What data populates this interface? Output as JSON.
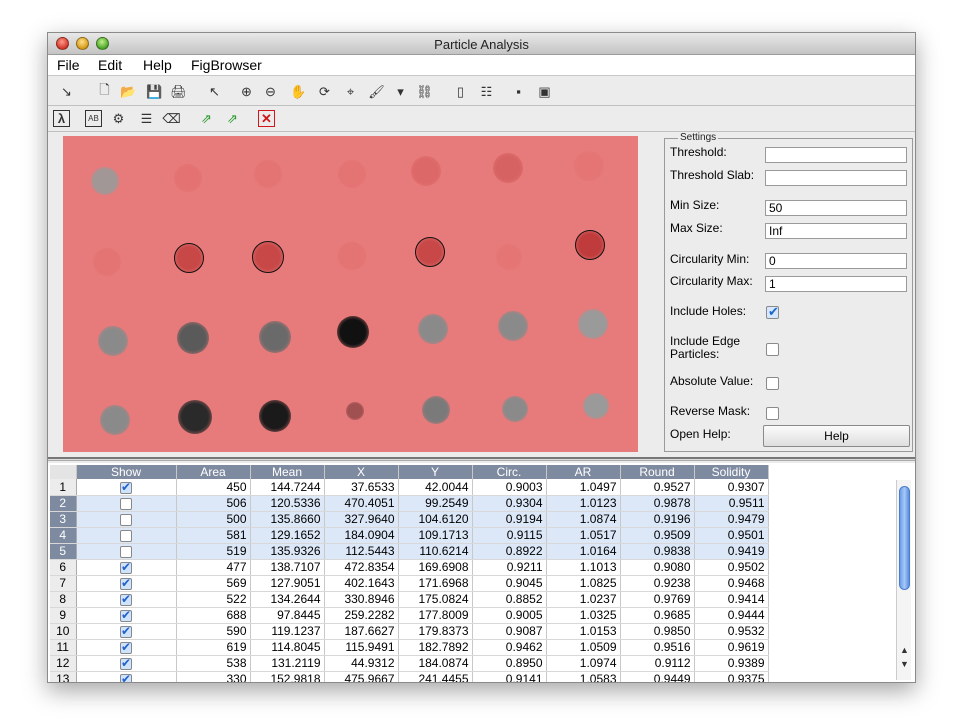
{
  "window": {
    "title": "Particle Analysis"
  },
  "menu": [
    "File",
    "Edit",
    "Help",
    "FigBrowser"
  ],
  "toolbar1": [
    {
      "icon": "dock-arrow-icon",
      "glyph": "↘"
    },
    {
      "icon": "new-file-icon",
      "glyph": "🗋"
    },
    {
      "icon": "open-folder-icon",
      "glyph": "📂"
    },
    {
      "icon": "save-icon",
      "glyph": "💾"
    },
    {
      "icon": "print-icon",
      "glyph": "🖨"
    },
    {
      "icon": "pointer-icon",
      "glyph": "↖"
    },
    {
      "icon": "zoom-in-icon",
      "glyph": "⊕"
    },
    {
      "icon": "zoom-out-icon",
      "glyph": "⊖"
    },
    {
      "icon": "pan-hand-icon",
      "glyph": "✋"
    },
    {
      "icon": "rotate-3d-icon",
      "glyph": "⟳"
    },
    {
      "icon": "data-cursor-icon",
      "glyph": "⌖"
    },
    {
      "icon": "brush-icon",
      "glyph": "🖌"
    },
    {
      "icon": "brush-dropdown-icon",
      "glyph": "▾"
    },
    {
      "icon": "link-plot-icon",
      "glyph": "⛓"
    },
    {
      "icon": "colorbar-icon",
      "glyph": "▯"
    },
    {
      "icon": "legend-icon",
      "glyph": "☷"
    },
    {
      "icon": "hide-plot-tools-icon",
      "glyph": "▪"
    },
    {
      "icon": "show-plot-tools-icon",
      "glyph": "▣"
    }
  ],
  "toolbar2": [
    {
      "icon": "lambda-icon",
      "glyph": "λ"
    },
    {
      "icon": "ab-label-icon",
      "glyph": "AB"
    },
    {
      "icon": "settings-gears-icon",
      "glyph": "⚙"
    },
    {
      "icon": "checklist-icon",
      "glyph": "☰"
    },
    {
      "icon": "eraser-icon",
      "glyph": "⌫"
    },
    {
      "icon": "export-icon",
      "glyph": "⇗"
    },
    {
      "icon": "export-color-icon",
      "glyph": "⇗"
    },
    {
      "icon": "close-red-icon",
      "glyph": "✕"
    }
  ],
  "settings": {
    "legend": "Settings",
    "threshold_label": "Threshold:",
    "threshold_value": "",
    "threshold_slab_label": "Threshold Slab:",
    "threshold_slab_value": "",
    "min_size_label": "Min Size:",
    "min_size_value": "50",
    "max_size_label": "Max Size:",
    "max_size_value": "Inf",
    "circ_min_label": "Circularity Min:",
    "circ_min_value": "0",
    "circ_max_label": "Circularity Max:",
    "circ_max_value": "1",
    "include_holes_label": "Include Holes:",
    "include_holes_checked": true,
    "include_edge_label_1": "Include Edge",
    "include_edge_label_2": "Particles:",
    "include_edge_checked": false,
    "absolute_value_label": "Absolute Value:",
    "absolute_value_checked": false,
    "reverse_mask_label": "Reverse Mask:",
    "reverse_mask_checked": false,
    "open_help_label": "Open Help:",
    "help_button": "Help"
  },
  "table": {
    "columns": [
      "Show",
      "Area",
      "Mean",
      "X",
      "Y",
      "Circ.",
      "AR",
      "Round",
      "Solidity"
    ],
    "rows": [
      {
        "n": "1",
        "show": true,
        "selected": false,
        "cells": [
          "450",
          "144.7244",
          "37.6533",
          "42.0044",
          "0.9003",
          "1.0497",
          "0.9527",
          "0.9307"
        ]
      },
      {
        "n": "2",
        "show": false,
        "selected": true,
        "cells": [
          "506",
          "120.5336",
          "470.4051",
          "99.2549",
          "0.9304",
          "1.0123",
          "0.9878",
          "0.9511"
        ]
      },
      {
        "n": "3",
        "show": false,
        "selected": true,
        "cells": [
          "500",
          "135.8660",
          "327.9640",
          "104.6120",
          "0.9194",
          "1.0874",
          "0.9196",
          "0.9479"
        ]
      },
      {
        "n": "4",
        "show": false,
        "selected": true,
        "cells": [
          "581",
          "129.1652",
          "184.0904",
          "109.1713",
          "0.9115",
          "1.0517",
          "0.9509",
          "0.9501"
        ]
      },
      {
        "n": "5",
        "show": false,
        "selected": true,
        "cells": [
          "519",
          "135.9326",
          "112.5443",
          "110.6214",
          "0.8922",
          "1.0164",
          "0.9838",
          "0.9419"
        ]
      },
      {
        "n": "6",
        "show": true,
        "selected": false,
        "cells": [
          "477",
          "138.7107",
          "472.8354",
          "169.6908",
          "0.9211",
          "1.1013",
          "0.9080",
          "0.9502"
        ]
      },
      {
        "n": "7",
        "show": true,
        "selected": false,
        "cells": [
          "569",
          "127.9051",
          "402.1643",
          "171.6968",
          "0.9045",
          "1.0825",
          "0.9238",
          "0.9468"
        ]
      },
      {
        "n": "8",
        "show": true,
        "selected": false,
        "cells": [
          "522",
          "134.2644",
          "330.8946",
          "175.0824",
          "0.8852",
          "1.0237",
          "0.9769",
          "0.9414"
        ]
      },
      {
        "n": "9",
        "show": true,
        "selected": false,
        "cells": [
          "688",
          "97.8445",
          "259.2282",
          "177.8009",
          "0.9005",
          "1.0325",
          "0.9685",
          "0.9444"
        ]
      },
      {
        "n": "10",
        "show": true,
        "selected": false,
        "cells": [
          "590",
          "119.1237",
          "187.6627",
          "179.8373",
          "0.9087",
          "1.0153",
          "0.9850",
          "0.9532"
        ]
      },
      {
        "n": "11",
        "show": true,
        "selected": false,
        "cells": [
          "619",
          "114.8045",
          "115.9491",
          "182.7892",
          "0.9462",
          "1.0509",
          "0.9516",
          "0.9619"
        ]
      },
      {
        "n": "12",
        "show": true,
        "selected": false,
        "cells": [
          "538",
          "131.2119",
          "44.9312",
          "184.0874",
          "0.8950",
          "1.0974",
          "0.9112",
          "0.9389"
        ]
      },
      {
        "n": "13",
        "show": true,
        "selected": false,
        "cells": [
          "330",
          "152.9818",
          "475.9667",
          "241.4455",
          "0.9141",
          "1.0583",
          "0.9449",
          "0.9375"
        ]
      }
    ]
  },
  "colors": {
    "image_background": "#e77a7a",
    "header_bg": "#7e8aa0",
    "selection_bg": "#dce8f8"
  }
}
